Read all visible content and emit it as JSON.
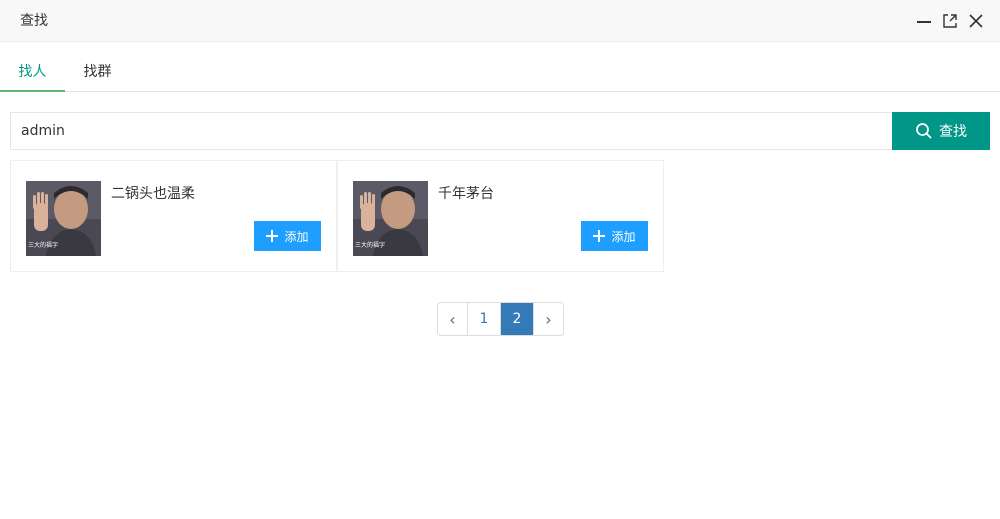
{
  "window": {
    "title": "查找",
    "controls": [
      "minimize-icon",
      "maximize-icon",
      "close-icon"
    ]
  },
  "tabs": [
    {
      "label": "找人",
      "active": true
    },
    {
      "label": "找群",
      "active": false
    }
  ],
  "search": {
    "value": "admin",
    "button_label": "查找",
    "button_icon": "search-icon"
  },
  "results": [
    {
      "name": "二锅头也温柔",
      "avatar_caption": "三大的福字",
      "add_label": "添加",
      "add_icon": "plus-icon"
    },
    {
      "name": "千年茅台",
      "avatar_caption": "三大的福字",
      "add_label": "添加",
      "add_icon": "plus-icon"
    }
  ],
  "pagination": {
    "prev": "‹",
    "pages": [
      "1",
      "2"
    ],
    "current": "2",
    "next": "›"
  },
  "colors": {
    "primary": "#009688",
    "tab_underline": "#5FB878",
    "add_button": "#1E9FFF",
    "pager_active": "#337ab7",
    "titlebar_bg": "#f8f8f8"
  }
}
